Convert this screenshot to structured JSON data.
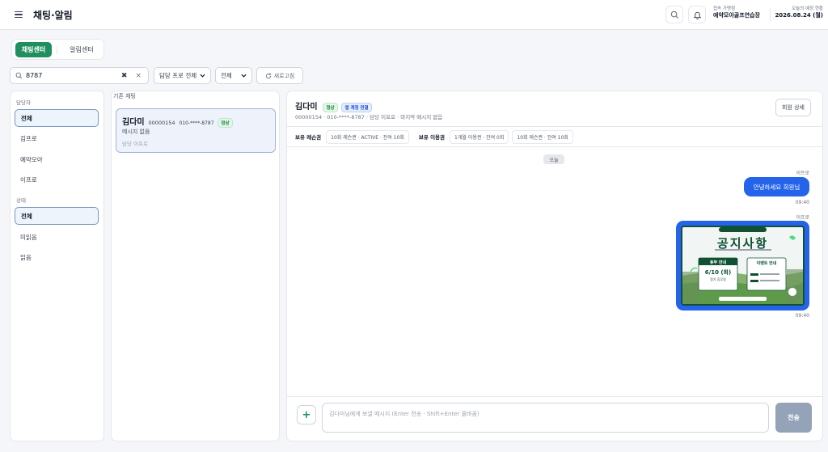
{
  "header": {
    "title": "채팅·알림",
    "store_label": "접속 가맹점",
    "store_name": "예약모아골프연습장",
    "today_label": "오늘의 예정 현황",
    "date": "2026.08.24 (월)"
  },
  "tabs": {
    "chat": "채팅센터",
    "notice": "알림센터",
    "active": "chat"
  },
  "filters": {
    "search_value": "8787",
    "clear_symbol": "✖",
    "close_symbol": "×",
    "pro_select": "담당 프로 전체",
    "status_select": "전체",
    "refresh": "새로고침"
  },
  "sidebar": {
    "manager_label": "담당자",
    "managers": [
      "전체",
      "김프로",
      "예약모아",
      "이프로"
    ],
    "status_label": "상태",
    "statuses": [
      "전체",
      "미읽음",
      "읽음"
    ]
  },
  "conversations": {
    "label": "기존 채팅",
    "items": [
      {
        "name": "김다미",
        "member_no": "00000154",
        "phone": "010-****-8787",
        "badge": "정상",
        "preview": "메시지 없음",
        "manager": "담당 이프로"
      }
    ]
  },
  "chat": {
    "name": "김다미",
    "badge_status": "정상",
    "badge_app": "앱 계정 연결",
    "info_line": "00000154 · 010-****-8787 · 담당 이프로 · 마지막 메시지 없음",
    "member_button": "회원 상세",
    "lesson_label": "보유 레슨권",
    "lesson_chips": [
      "10회 레슨권 · ACTIVE · 잔여 10회"
    ],
    "usage_label": "보유 이용권",
    "usage_chips": [
      "1개월 이용권 · 잔여 0회",
      "10회 레슨권 · 잔여 10회"
    ],
    "date_divider": "오늘",
    "messages": [
      {
        "sender": "이프로",
        "text": "안녕하세요 회원님",
        "time": "09:40"
      },
      {
        "sender": "이프로",
        "type": "image",
        "time": "09:40"
      }
    ],
    "poster": {
      "title": "공지사항",
      "left_header": "휴무 안내",
      "left_date": "6/10 (화)",
      "left_sub": "정기 휴무일",
      "right_header": "이벤트 안내"
    },
    "composer_placeholder": "김다미님에게 보낼 메시지 (Enter 전송 · Shift+Enter 줄바꿈)",
    "plus_symbol": "+",
    "send_button": "전송"
  },
  "colors": {
    "brand_green": "#1f8f5f",
    "chat_blue": "#2563eb",
    "send_disabled": "#94a3b8"
  }
}
